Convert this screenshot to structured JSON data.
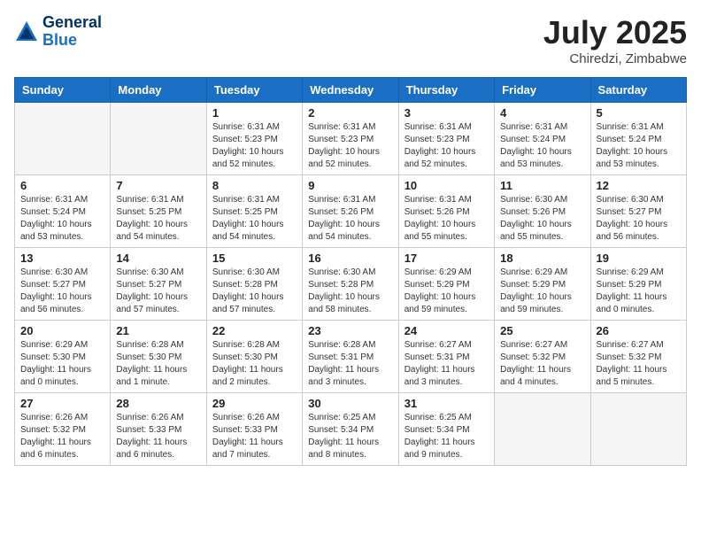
{
  "header": {
    "logo_line1": "General",
    "logo_line2": "Blue",
    "month_title": "July 2025",
    "location": "Chiredzi, Zimbabwe"
  },
  "weekdays": [
    "Sunday",
    "Monday",
    "Tuesday",
    "Wednesday",
    "Thursday",
    "Friday",
    "Saturday"
  ],
  "weeks": [
    [
      {
        "day": "",
        "empty": true
      },
      {
        "day": "",
        "empty": true
      },
      {
        "day": "1",
        "sunrise": "6:31 AM",
        "sunset": "5:23 PM",
        "daylight": "10 hours and 52 minutes."
      },
      {
        "day": "2",
        "sunrise": "6:31 AM",
        "sunset": "5:23 PM",
        "daylight": "10 hours and 52 minutes."
      },
      {
        "day": "3",
        "sunrise": "6:31 AM",
        "sunset": "5:23 PM",
        "daylight": "10 hours and 52 minutes."
      },
      {
        "day": "4",
        "sunrise": "6:31 AM",
        "sunset": "5:24 PM",
        "daylight": "10 hours and 53 minutes."
      },
      {
        "day": "5",
        "sunrise": "6:31 AM",
        "sunset": "5:24 PM",
        "daylight": "10 hours and 53 minutes."
      }
    ],
    [
      {
        "day": "6",
        "sunrise": "6:31 AM",
        "sunset": "5:24 PM",
        "daylight": "10 hours and 53 minutes."
      },
      {
        "day": "7",
        "sunrise": "6:31 AM",
        "sunset": "5:25 PM",
        "daylight": "10 hours and 54 minutes."
      },
      {
        "day": "8",
        "sunrise": "6:31 AM",
        "sunset": "5:25 PM",
        "daylight": "10 hours and 54 minutes."
      },
      {
        "day": "9",
        "sunrise": "6:31 AM",
        "sunset": "5:26 PM",
        "daylight": "10 hours and 54 minutes."
      },
      {
        "day": "10",
        "sunrise": "6:31 AM",
        "sunset": "5:26 PM",
        "daylight": "10 hours and 55 minutes."
      },
      {
        "day": "11",
        "sunrise": "6:30 AM",
        "sunset": "5:26 PM",
        "daylight": "10 hours and 55 minutes."
      },
      {
        "day": "12",
        "sunrise": "6:30 AM",
        "sunset": "5:27 PM",
        "daylight": "10 hours and 56 minutes."
      }
    ],
    [
      {
        "day": "13",
        "sunrise": "6:30 AM",
        "sunset": "5:27 PM",
        "daylight": "10 hours and 56 minutes."
      },
      {
        "day": "14",
        "sunrise": "6:30 AM",
        "sunset": "5:27 PM",
        "daylight": "10 hours and 57 minutes."
      },
      {
        "day": "15",
        "sunrise": "6:30 AM",
        "sunset": "5:28 PM",
        "daylight": "10 hours and 57 minutes."
      },
      {
        "day": "16",
        "sunrise": "6:30 AM",
        "sunset": "5:28 PM",
        "daylight": "10 hours and 58 minutes."
      },
      {
        "day": "17",
        "sunrise": "6:29 AM",
        "sunset": "5:29 PM",
        "daylight": "10 hours and 59 minutes."
      },
      {
        "day": "18",
        "sunrise": "6:29 AM",
        "sunset": "5:29 PM",
        "daylight": "10 hours and 59 minutes."
      },
      {
        "day": "19",
        "sunrise": "6:29 AM",
        "sunset": "5:29 PM",
        "daylight": "11 hours and 0 minutes."
      }
    ],
    [
      {
        "day": "20",
        "sunrise": "6:29 AM",
        "sunset": "5:30 PM",
        "daylight": "11 hours and 0 minutes."
      },
      {
        "day": "21",
        "sunrise": "6:28 AM",
        "sunset": "5:30 PM",
        "daylight": "11 hours and 1 minute."
      },
      {
        "day": "22",
        "sunrise": "6:28 AM",
        "sunset": "5:30 PM",
        "daylight": "11 hours and 2 minutes."
      },
      {
        "day": "23",
        "sunrise": "6:28 AM",
        "sunset": "5:31 PM",
        "daylight": "11 hours and 3 minutes."
      },
      {
        "day": "24",
        "sunrise": "6:27 AM",
        "sunset": "5:31 PM",
        "daylight": "11 hours and 3 minutes."
      },
      {
        "day": "25",
        "sunrise": "6:27 AM",
        "sunset": "5:32 PM",
        "daylight": "11 hours and 4 minutes."
      },
      {
        "day": "26",
        "sunrise": "6:27 AM",
        "sunset": "5:32 PM",
        "daylight": "11 hours and 5 minutes."
      }
    ],
    [
      {
        "day": "27",
        "sunrise": "6:26 AM",
        "sunset": "5:32 PM",
        "daylight": "11 hours and 6 minutes."
      },
      {
        "day": "28",
        "sunrise": "6:26 AM",
        "sunset": "5:33 PM",
        "daylight": "11 hours and 6 minutes."
      },
      {
        "day": "29",
        "sunrise": "6:26 AM",
        "sunset": "5:33 PM",
        "daylight": "11 hours and 7 minutes."
      },
      {
        "day": "30",
        "sunrise": "6:25 AM",
        "sunset": "5:34 PM",
        "daylight": "11 hours and 8 minutes."
      },
      {
        "day": "31",
        "sunrise": "6:25 AM",
        "sunset": "5:34 PM",
        "daylight": "11 hours and 9 minutes."
      },
      {
        "day": "",
        "empty": true
      },
      {
        "day": "",
        "empty": true
      }
    ]
  ]
}
